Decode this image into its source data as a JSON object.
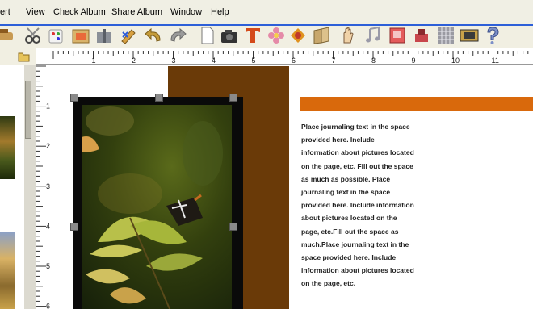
{
  "menu": {
    "items": [
      {
        "label": "ert"
      },
      {
        "label": "View"
      },
      {
        "label": "Check Album"
      },
      {
        "label": "Share Album"
      },
      {
        "label": "Window"
      },
      {
        "label": "Help"
      }
    ]
  },
  "toolbar": {
    "icons": [
      "stamp-icon",
      "scissors-icon",
      "dice-icon",
      "photo-frame-icon",
      "gift-icon",
      "edit-icon",
      "undo-icon",
      "redo-icon",
      "blank-page-icon",
      "camera-icon",
      "text-tool-icon",
      "flower-icon",
      "paint-icon",
      "book-icon",
      "hand-icon",
      "music-note-icon",
      "image-tool-icon",
      "stamp-pad-icon",
      "grid-icon",
      "film-icon",
      "help-icon"
    ]
  },
  "ruler": {
    "horizontal_labels": [
      "1",
      "2",
      "3",
      "4",
      "5",
      "6",
      "7",
      "8",
      "9",
      "10",
      "11"
    ],
    "vertical_labels": [
      "1",
      "2",
      "3",
      "4",
      "5",
      "6"
    ]
  },
  "page": {
    "journal_lines": [
      "Place journaling text in the space",
      "provided here.  Include",
      "information about pictures located",
      "on the page, etc. Fill out the space",
      "as much as possible. Place",
      "journaling text in the space",
      "provided here. Include information",
      "about pictures located on the",
      "page, etc.Fill out the space as",
      "much.Place journaling text in the",
      "space provided here.  Include",
      "information about pictures located",
      "on the page, etc."
    ]
  },
  "colors": {
    "brown_band": "#6a3a08",
    "orange_bar": "#d9690c",
    "menu_border": "#2d5fd8"
  }
}
